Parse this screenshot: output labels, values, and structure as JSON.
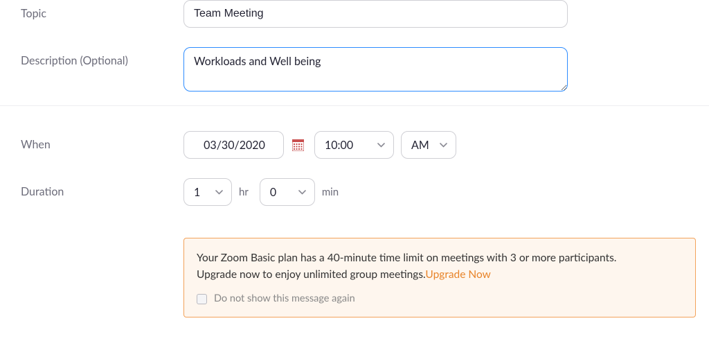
{
  "labels": {
    "topic": "Topic",
    "description": "Description (Optional)",
    "when": "When",
    "duration": "Duration"
  },
  "values": {
    "topic": "Team Meeting",
    "description": "Workloads and Well being",
    "date": "03/30/2020",
    "time": "10:00",
    "ampm": "AM",
    "duration_hr": "1",
    "duration_min": "0"
  },
  "units": {
    "hr": "hr",
    "min": "min"
  },
  "notice": {
    "line1": "Your Zoom Basic plan has a 40-minute time limit on meetings with 3 or more participants.",
    "line2_prefix": "Upgrade now to enjoy unlimited group meetings.",
    "link": "Upgrade Now",
    "checkbox_label": "Do not show this message again"
  }
}
